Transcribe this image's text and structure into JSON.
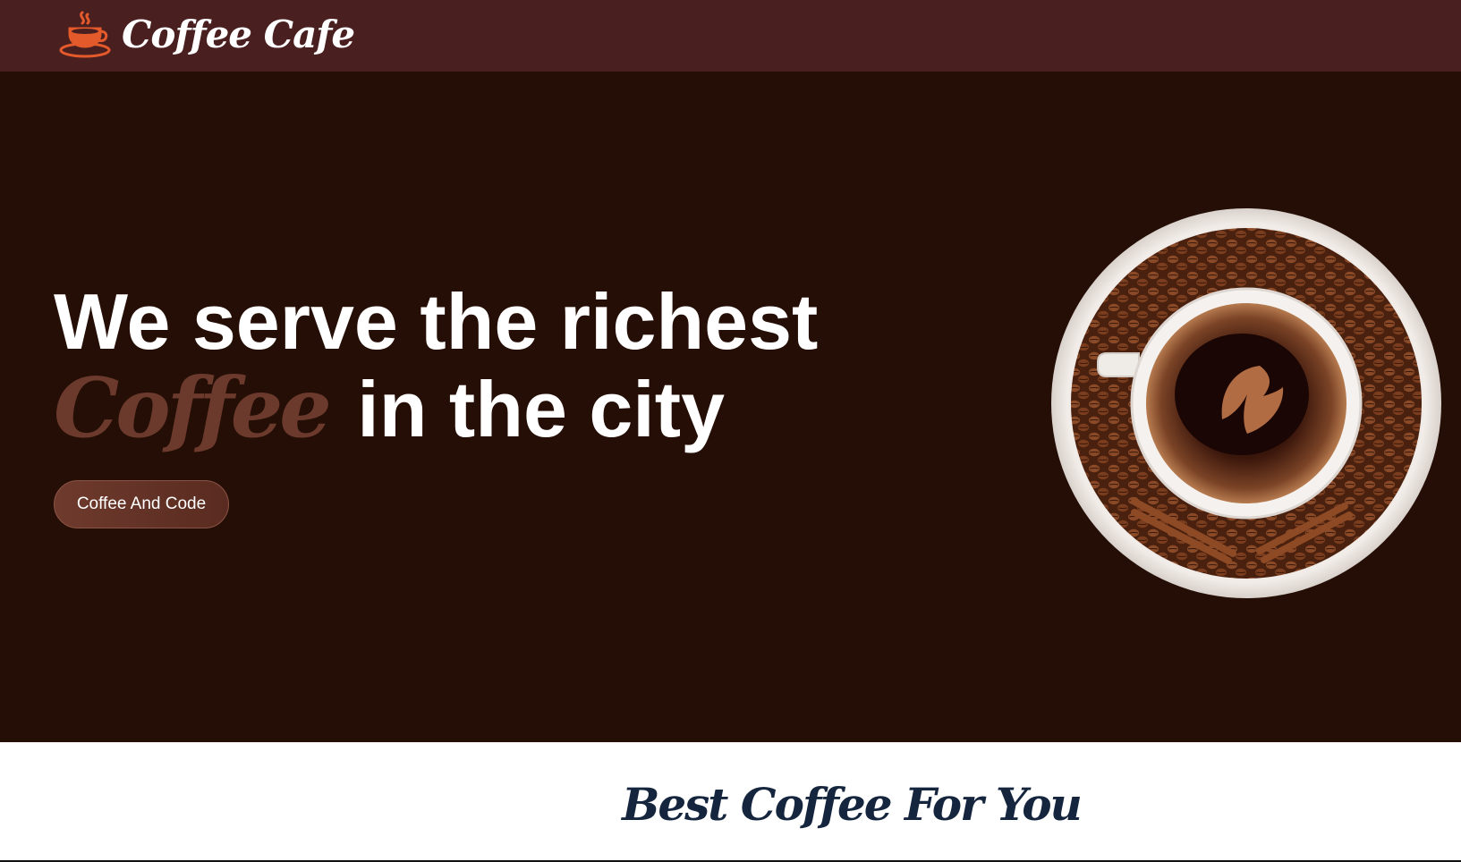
{
  "navbar": {
    "brand_name": "Coffee Cafe",
    "brand_icon": "coffee-cup-icon",
    "background": "#4a1f1f",
    "icon_color": "#e55a2b"
  },
  "hero": {
    "background": "#250e05",
    "headline_line1": "We serve the richest",
    "headline_accent": "Coffee",
    "headline_line2_rest": "in the city",
    "cta_label": "Coffee And Code",
    "image": "coffee-cup-with-beans-image"
  },
  "section": {
    "title": "Best Coffee For You"
  }
}
